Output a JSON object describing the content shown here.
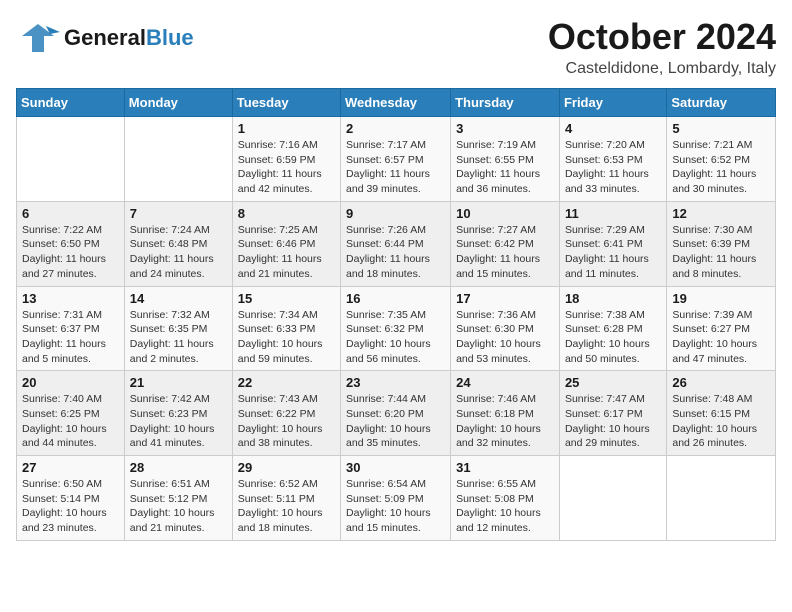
{
  "header": {
    "logo_general": "General",
    "logo_blue": "Blue",
    "month": "October 2024",
    "location": "Casteldidone, Lombardy, Italy"
  },
  "weekdays": [
    "Sunday",
    "Monday",
    "Tuesday",
    "Wednesday",
    "Thursday",
    "Friday",
    "Saturday"
  ],
  "weeks": [
    [
      {
        "day": "",
        "info": ""
      },
      {
        "day": "",
        "info": ""
      },
      {
        "day": "1",
        "sunrise": "Sunrise: 7:16 AM",
        "sunset": "Sunset: 6:59 PM",
        "daylight": "Daylight: 11 hours and 42 minutes."
      },
      {
        "day": "2",
        "sunrise": "Sunrise: 7:17 AM",
        "sunset": "Sunset: 6:57 PM",
        "daylight": "Daylight: 11 hours and 39 minutes."
      },
      {
        "day": "3",
        "sunrise": "Sunrise: 7:19 AM",
        "sunset": "Sunset: 6:55 PM",
        "daylight": "Daylight: 11 hours and 36 minutes."
      },
      {
        "day": "4",
        "sunrise": "Sunrise: 7:20 AM",
        "sunset": "Sunset: 6:53 PM",
        "daylight": "Daylight: 11 hours and 33 minutes."
      },
      {
        "day": "5",
        "sunrise": "Sunrise: 7:21 AM",
        "sunset": "Sunset: 6:52 PM",
        "daylight": "Daylight: 11 hours and 30 minutes."
      }
    ],
    [
      {
        "day": "6",
        "sunrise": "Sunrise: 7:22 AM",
        "sunset": "Sunset: 6:50 PM",
        "daylight": "Daylight: 11 hours and 27 minutes."
      },
      {
        "day": "7",
        "sunrise": "Sunrise: 7:24 AM",
        "sunset": "Sunset: 6:48 PM",
        "daylight": "Daylight: 11 hours and 24 minutes."
      },
      {
        "day": "8",
        "sunrise": "Sunrise: 7:25 AM",
        "sunset": "Sunset: 6:46 PM",
        "daylight": "Daylight: 11 hours and 21 minutes."
      },
      {
        "day": "9",
        "sunrise": "Sunrise: 7:26 AM",
        "sunset": "Sunset: 6:44 PM",
        "daylight": "Daylight: 11 hours and 18 minutes."
      },
      {
        "day": "10",
        "sunrise": "Sunrise: 7:27 AM",
        "sunset": "Sunset: 6:42 PM",
        "daylight": "Daylight: 11 hours and 15 minutes."
      },
      {
        "day": "11",
        "sunrise": "Sunrise: 7:29 AM",
        "sunset": "Sunset: 6:41 PM",
        "daylight": "Daylight: 11 hours and 11 minutes."
      },
      {
        "day": "12",
        "sunrise": "Sunrise: 7:30 AM",
        "sunset": "Sunset: 6:39 PM",
        "daylight": "Daylight: 11 hours and 8 minutes."
      }
    ],
    [
      {
        "day": "13",
        "sunrise": "Sunrise: 7:31 AM",
        "sunset": "Sunset: 6:37 PM",
        "daylight": "Daylight: 11 hours and 5 minutes."
      },
      {
        "day": "14",
        "sunrise": "Sunrise: 7:32 AM",
        "sunset": "Sunset: 6:35 PM",
        "daylight": "Daylight: 11 hours and 2 minutes."
      },
      {
        "day": "15",
        "sunrise": "Sunrise: 7:34 AM",
        "sunset": "Sunset: 6:33 PM",
        "daylight": "Daylight: 10 hours and 59 minutes."
      },
      {
        "day": "16",
        "sunrise": "Sunrise: 7:35 AM",
        "sunset": "Sunset: 6:32 PM",
        "daylight": "Daylight: 10 hours and 56 minutes."
      },
      {
        "day": "17",
        "sunrise": "Sunrise: 7:36 AM",
        "sunset": "Sunset: 6:30 PM",
        "daylight": "Daylight: 10 hours and 53 minutes."
      },
      {
        "day": "18",
        "sunrise": "Sunrise: 7:38 AM",
        "sunset": "Sunset: 6:28 PM",
        "daylight": "Daylight: 10 hours and 50 minutes."
      },
      {
        "day": "19",
        "sunrise": "Sunrise: 7:39 AM",
        "sunset": "Sunset: 6:27 PM",
        "daylight": "Daylight: 10 hours and 47 minutes."
      }
    ],
    [
      {
        "day": "20",
        "sunrise": "Sunrise: 7:40 AM",
        "sunset": "Sunset: 6:25 PM",
        "daylight": "Daylight: 10 hours and 44 minutes."
      },
      {
        "day": "21",
        "sunrise": "Sunrise: 7:42 AM",
        "sunset": "Sunset: 6:23 PM",
        "daylight": "Daylight: 10 hours and 41 minutes."
      },
      {
        "day": "22",
        "sunrise": "Sunrise: 7:43 AM",
        "sunset": "Sunset: 6:22 PM",
        "daylight": "Daylight: 10 hours and 38 minutes."
      },
      {
        "day": "23",
        "sunrise": "Sunrise: 7:44 AM",
        "sunset": "Sunset: 6:20 PM",
        "daylight": "Daylight: 10 hours and 35 minutes."
      },
      {
        "day": "24",
        "sunrise": "Sunrise: 7:46 AM",
        "sunset": "Sunset: 6:18 PM",
        "daylight": "Daylight: 10 hours and 32 minutes."
      },
      {
        "day": "25",
        "sunrise": "Sunrise: 7:47 AM",
        "sunset": "Sunset: 6:17 PM",
        "daylight": "Daylight: 10 hours and 29 minutes."
      },
      {
        "day": "26",
        "sunrise": "Sunrise: 7:48 AM",
        "sunset": "Sunset: 6:15 PM",
        "daylight": "Daylight: 10 hours and 26 minutes."
      }
    ],
    [
      {
        "day": "27",
        "sunrise": "Sunrise: 6:50 AM",
        "sunset": "Sunset: 5:14 PM",
        "daylight": "Daylight: 10 hours and 23 minutes."
      },
      {
        "day": "28",
        "sunrise": "Sunrise: 6:51 AM",
        "sunset": "Sunset: 5:12 PM",
        "daylight": "Daylight: 10 hours and 21 minutes."
      },
      {
        "day": "29",
        "sunrise": "Sunrise: 6:52 AM",
        "sunset": "Sunset: 5:11 PM",
        "daylight": "Daylight: 10 hours and 18 minutes."
      },
      {
        "day": "30",
        "sunrise": "Sunrise: 6:54 AM",
        "sunset": "Sunset: 5:09 PM",
        "daylight": "Daylight: 10 hours and 15 minutes."
      },
      {
        "day": "31",
        "sunrise": "Sunrise: 6:55 AM",
        "sunset": "Sunset: 5:08 PM",
        "daylight": "Daylight: 10 hours and 12 minutes."
      },
      {
        "day": "",
        "info": ""
      },
      {
        "day": "",
        "info": ""
      }
    ]
  ]
}
